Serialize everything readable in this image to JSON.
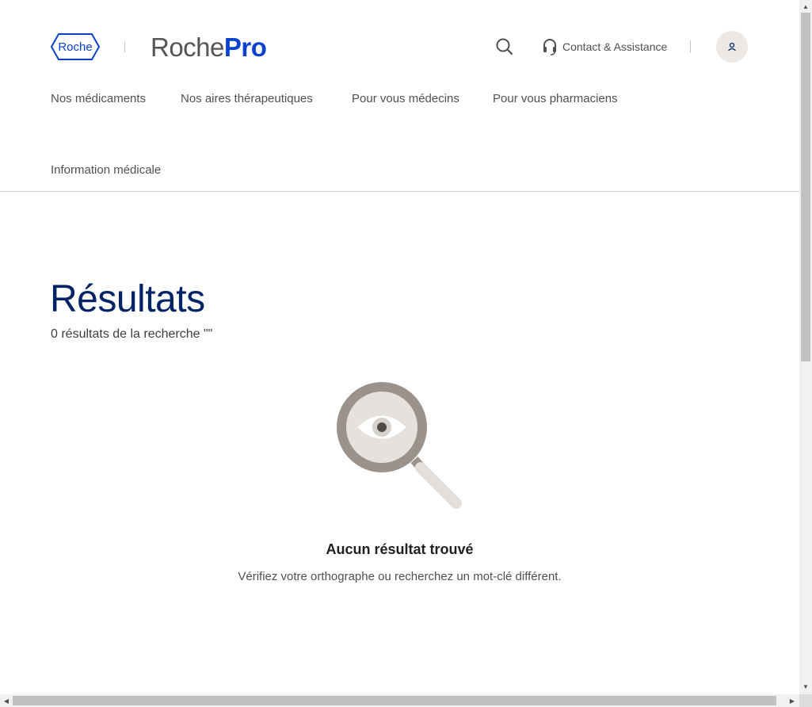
{
  "header": {
    "roche_logo_text": "Roche",
    "brand_part1": "Roche",
    "brand_part2": "Pro",
    "contact_label": "Contact & Assistance"
  },
  "nav": {
    "items": [
      "Nos médicaments",
      "Nos aires thérapeutiques",
      "Pour vous médecins",
      "Pour vous pharmaciens",
      "Information médicale"
    ]
  },
  "results": {
    "title": "Résultats",
    "summary": "0 résultats de la recherche \"\"",
    "empty_title": "Aucun résultat trouvé",
    "empty_text": "Vérifiez votre orthographe ou recherchez un mot-clé différent."
  },
  "icons": {
    "search": "search-icon",
    "contact": "headset-icon",
    "user": "user-icon",
    "illustration": "magnifier-eye-illustration"
  },
  "colors": {
    "brand_blue": "#0b41cd",
    "title_navy": "#022366",
    "nav_text": "#544f4f"
  }
}
